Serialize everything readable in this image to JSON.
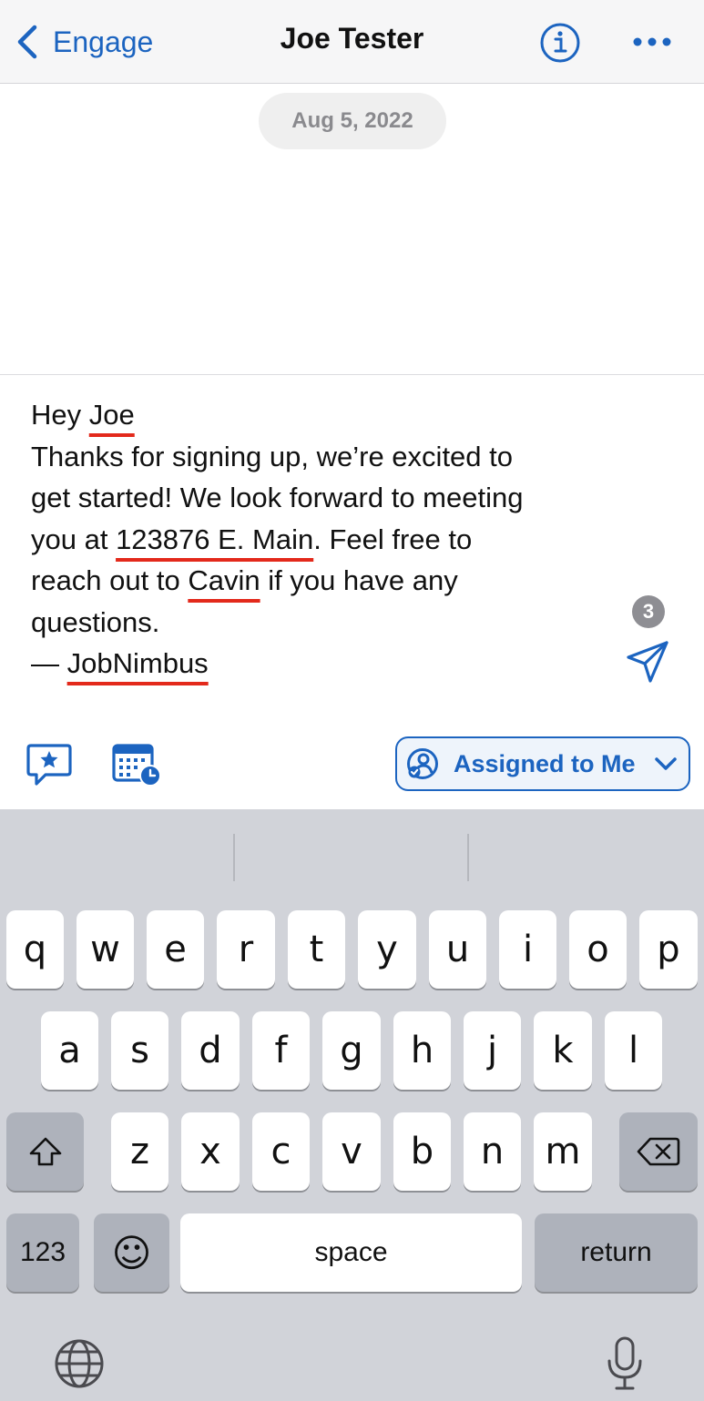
{
  "nav": {
    "back_label": "Engage",
    "title": "Joe Tester"
  },
  "thread": {
    "date": "Aug 5, 2022"
  },
  "compose": {
    "lines": [
      [
        "Hey ",
        "Joe",
        ""
      ],
      [
        "Thanks for signing up, we’re excited to"
      ],
      [
        "get started! We look forward to meeting"
      ],
      [
        "you at ",
        "123876 E. Main",
        ". Feel free to"
      ],
      [
        "reach out to ",
        "Cavin",
        " if you have any"
      ],
      [
        "questions."
      ],
      [
        "— ",
        "JobNimbus",
        ""
      ]
    ],
    "char_counter": "3"
  },
  "toolbar": {
    "assign_label": "Assigned to Me"
  },
  "keyboard": {
    "row1": [
      "q",
      "w",
      "e",
      "r",
      "t",
      "y",
      "u",
      "i",
      "o",
      "p"
    ],
    "row2": [
      "a",
      "s",
      "d",
      "f",
      "g",
      "h",
      "j",
      "k",
      "l"
    ],
    "row3": [
      "z",
      "x",
      "c",
      "v",
      "b",
      "n",
      "m"
    ],
    "numbers_label": "123",
    "emoji": "☺",
    "space_label": "space",
    "return_label": "return"
  },
  "icons": {
    "back": "chevron-left-icon",
    "info": "info-icon",
    "more": "ellipsis-icon",
    "send": "paper-plane-icon",
    "template": "speech-bubble-star-icon",
    "schedule": "calendar-clock-icon",
    "assign": "user-check-icon",
    "chevron": "chevron-down-icon",
    "shift": "shift-icon",
    "delete": "backspace-icon",
    "globe": "globe-icon",
    "mic": "microphone-icon"
  },
  "colors": {
    "accent": "#1c64c0",
    "underline": "#e3291b",
    "keyboard_bg": "#d1d3d9"
  }
}
